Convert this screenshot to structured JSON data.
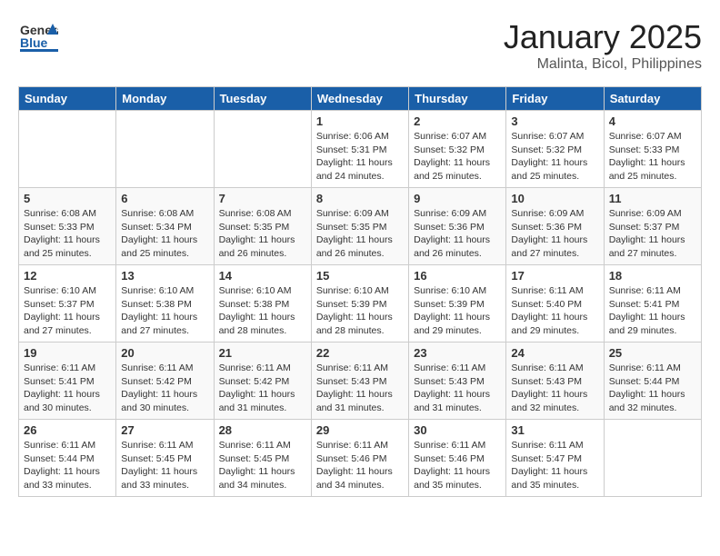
{
  "header": {
    "logo_general": "General",
    "logo_blue": "Blue",
    "month_title": "January 2025",
    "location": "Malinta, Bicol, Philippines"
  },
  "weekdays": [
    "Sunday",
    "Monday",
    "Tuesday",
    "Wednesday",
    "Thursday",
    "Friday",
    "Saturday"
  ],
  "weeks": [
    [
      {
        "day": "",
        "sunrise": "",
        "sunset": "",
        "daylight": ""
      },
      {
        "day": "",
        "sunrise": "",
        "sunset": "",
        "daylight": ""
      },
      {
        "day": "",
        "sunrise": "",
        "sunset": "",
        "daylight": ""
      },
      {
        "day": "1",
        "sunrise": "Sunrise: 6:06 AM",
        "sunset": "Sunset: 5:31 PM",
        "daylight": "Daylight: 11 hours and 24 minutes."
      },
      {
        "day": "2",
        "sunrise": "Sunrise: 6:07 AM",
        "sunset": "Sunset: 5:32 PM",
        "daylight": "Daylight: 11 hours and 25 minutes."
      },
      {
        "day": "3",
        "sunrise": "Sunrise: 6:07 AM",
        "sunset": "Sunset: 5:32 PM",
        "daylight": "Daylight: 11 hours and 25 minutes."
      },
      {
        "day": "4",
        "sunrise": "Sunrise: 6:07 AM",
        "sunset": "Sunset: 5:33 PM",
        "daylight": "Daylight: 11 hours and 25 minutes."
      }
    ],
    [
      {
        "day": "5",
        "sunrise": "Sunrise: 6:08 AM",
        "sunset": "Sunset: 5:33 PM",
        "daylight": "Daylight: 11 hours and 25 minutes."
      },
      {
        "day": "6",
        "sunrise": "Sunrise: 6:08 AM",
        "sunset": "Sunset: 5:34 PM",
        "daylight": "Daylight: 11 hours and 25 minutes."
      },
      {
        "day": "7",
        "sunrise": "Sunrise: 6:08 AM",
        "sunset": "Sunset: 5:35 PM",
        "daylight": "Daylight: 11 hours and 26 minutes."
      },
      {
        "day": "8",
        "sunrise": "Sunrise: 6:09 AM",
        "sunset": "Sunset: 5:35 PM",
        "daylight": "Daylight: 11 hours and 26 minutes."
      },
      {
        "day": "9",
        "sunrise": "Sunrise: 6:09 AM",
        "sunset": "Sunset: 5:36 PM",
        "daylight": "Daylight: 11 hours and 26 minutes."
      },
      {
        "day": "10",
        "sunrise": "Sunrise: 6:09 AM",
        "sunset": "Sunset: 5:36 PM",
        "daylight": "Daylight: 11 hours and 27 minutes."
      },
      {
        "day": "11",
        "sunrise": "Sunrise: 6:09 AM",
        "sunset": "Sunset: 5:37 PM",
        "daylight": "Daylight: 11 hours and 27 minutes."
      }
    ],
    [
      {
        "day": "12",
        "sunrise": "Sunrise: 6:10 AM",
        "sunset": "Sunset: 5:37 PM",
        "daylight": "Daylight: 11 hours and 27 minutes."
      },
      {
        "day": "13",
        "sunrise": "Sunrise: 6:10 AM",
        "sunset": "Sunset: 5:38 PM",
        "daylight": "Daylight: 11 hours and 27 minutes."
      },
      {
        "day": "14",
        "sunrise": "Sunrise: 6:10 AM",
        "sunset": "Sunset: 5:38 PM",
        "daylight": "Daylight: 11 hours and 28 minutes."
      },
      {
        "day": "15",
        "sunrise": "Sunrise: 6:10 AM",
        "sunset": "Sunset: 5:39 PM",
        "daylight": "Daylight: 11 hours and 28 minutes."
      },
      {
        "day": "16",
        "sunrise": "Sunrise: 6:10 AM",
        "sunset": "Sunset: 5:39 PM",
        "daylight": "Daylight: 11 hours and 29 minutes."
      },
      {
        "day": "17",
        "sunrise": "Sunrise: 6:11 AM",
        "sunset": "Sunset: 5:40 PM",
        "daylight": "Daylight: 11 hours and 29 minutes."
      },
      {
        "day": "18",
        "sunrise": "Sunrise: 6:11 AM",
        "sunset": "Sunset: 5:41 PM",
        "daylight": "Daylight: 11 hours and 29 minutes."
      }
    ],
    [
      {
        "day": "19",
        "sunrise": "Sunrise: 6:11 AM",
        "sunset": "Sunset: 5:41 PM",
        "daylight": "Daylight: 11 hours and 30 minutes."
      },
      {
        "day": "20",
        "sunrise": "Sunrise: 6:11 AM",
        "sunset": "Sunset: 5:42 PM",
        "daylight": "Daylight: 11 hours and 30 minutes."
      },
      {
        "day": "21",
        "sunrise": "Sunrise: 6:11 AM",
        "sunset": "Sunset: 5:42 PM",
        "daylight": "Daylight: 11 hours and 31 minutes."
      },
      {
        "day": "22",
        "sunrise": "Sunrise: 6:11 AM",
        "sunset": "Sunset: 5:43 PM",
        "daylight": "Daylight: 11 hours and 31 minutes."
      },
      {
        "day": "23",
        "sunrise": "Sunrise: 6:11 AM",
        "sunset": "Sunset: 5:43 PM",
        "daylight": "Daylight: 11 hours and 31 minutes."
      },
      {
        "day": "24",
        "sunrise": "Sunrise: 6:11 AM",
        "sunset": "Sunset: 5:43 PM",
        "daylight": "Daylight: 11 hours and 32 minutes."
      },
      {
        "day": "25",
        "sunrise": "Sunrise: 6:11 AM",
        "sunset": "Sunset: 5:44 PM",
        "daylight": "Daylight: 11 hours and 32 minutes."
      }
    ],
    [
      {
        "day": "26",
        "sunrise": "Sunrise: 6:11 AM",
        "sunset": "Sunset: 5:44 PM",
        "daylight": "Daylight: 11 hours and 33 minutes."
      },
      {
        "day": "27",
        "sunrise": "Sunrise: 6:11 AM",
        "sunset": "Sunset: 5:45 PM",
        "daylight": "Daylight: 11 hours and 33 minutes."
      },
      {
        "day": "28",
        "sunrise": "Sunrise: 6:11 AM",
        "sunset": "Sunset: 5:45 PM",
        "daylight": "Daylight: 11 hours and 34 minutes."
      },
      {
        "day": "29",
        "sunrise": "Sunrise: 6:11 AM",
        "sunset": "Sunset: 5:46 PM",
        "daylight": "Daylight: 11 hours and 34 minutes."
      },
      {
        "day": "30",
        "sunrise": "Sunrise: 6:11 AM",
        "sunset": "Sunset: 5:46 PM",
        "daylight": "Daylight: 11 hours and 35 minutes."
      },
      {
        "day": "31",
        "sunrise": "Sunrise: 6:11 AM",
        "sunset": "Sunset: 5:47 PM",
        "daylight": "Daylight: 11 hours and 35 minutes."
      },
      {
        "day": "",
        "sunrise": "",
        "sunset": "",
        "daylight": ""
      }
    ]
  ]
}
